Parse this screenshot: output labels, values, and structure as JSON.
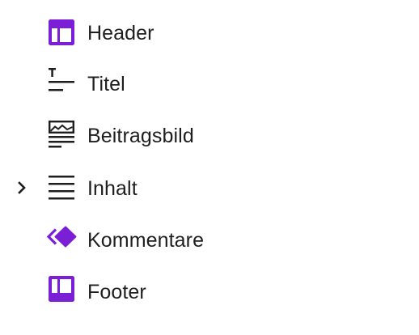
{
  "colors": {
    "accent": "#7a1fd6",
    "text": "#1e1e1e",
    "background": "#ffffff"
  },
  "list_view": {
    "items": [
      {
        "label": "Header",
        "icon": "template-part-header-icon",
        "expandable": false
      },
      {
        "label": "Titel",
        "icon": "post-title-icon",
        "expandable": false
      },
      {
        "label": "Beitragsbild",
        "icon": "featured-image-icon",
        "expandable": false
      },
      {
        "label": "Inhalt",
        "icon": "post-content-icon",
        "expandable": true
      },
      {
        "label": "Kommentare",
        "icon": "comments-block-icon",
        "expandable": false
      },
      {
        "label": "Footer",
        "icon": "template-part-footer-icon",
        "expandable": false
      }
    ]
  }
}
